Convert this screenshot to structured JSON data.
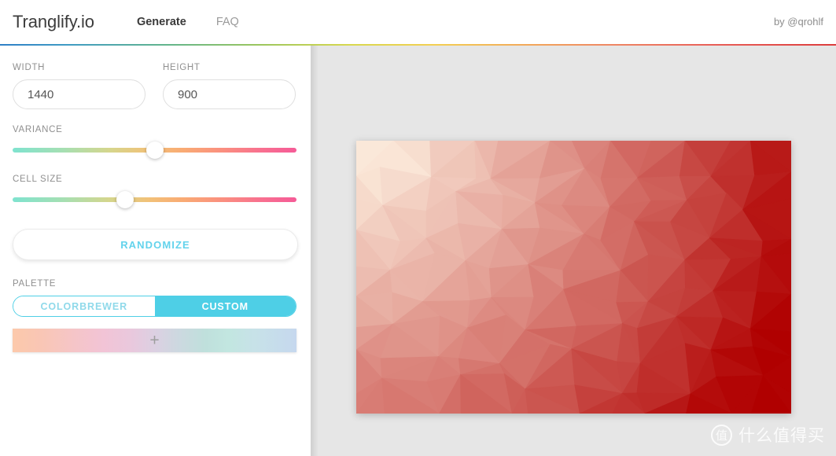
{
  "header": {
    "brand": "Tranglify.io",
    "nav": [
      {
        "label": "Generate",
        "active": true
      },
      {
        "label": "FAQ",
        "active": false
      }
    ],
    "byline": "by @qrohlf",
    "rule_colors": [
      "#2f7fc6",
      "#9bc65e",
      "#d8d84e",
      "#f2a85a",
      "#dc3c3c"
    ]
  },
  "sidebar": {
    "width": {
      "label": "WIDTH",
      "value": "1440"
    },
    "height": {
      "label": "HEIGHT",
      "value": "900"
    },
    "variance": {
      "label": "VARIANCE",
      "knob_percent": 50
    },
    "cell_size": {
      "label": "CELL SIZE",
      "knob_percent": 39
    },
    "randomize": {
      "label": "RANDOMIZE",
      "accent": "#63d3ec"
    },
    "palette": {
      "label": "PALETTE",
      "options": [
        {
          "label": "COLORBREWER",
          "active": false
        },
        {
          "label": "CUSTOM",
          "active": true
        }
      ],
      "accent": "#4ecfe6",
      "add_icon": "plus-icon",
      "strip_stops": [
        "#fcc9ab",
        "#f5c5c8",
        "#dcd0e2",
        "#bfe0dc",
        "#c6d8ee"
      ]
    },
    "slider_gradient_stops": [
      "#7fe3cf",
      "#d5d68d",
      "#f9ab74",
      "#f55b97"
    ]
  },
  "preview": {
    "background": "#e6e6e6",
    "canvas": {
      "palette_from": "#fdf0e0",
      "palette_to": "#b00000",
      "rows": 9,
      "cols": 12
    }
  },
  "watermark": {
    "badge_glyph": "值",
    "text": "什么值得买"
  }
}
